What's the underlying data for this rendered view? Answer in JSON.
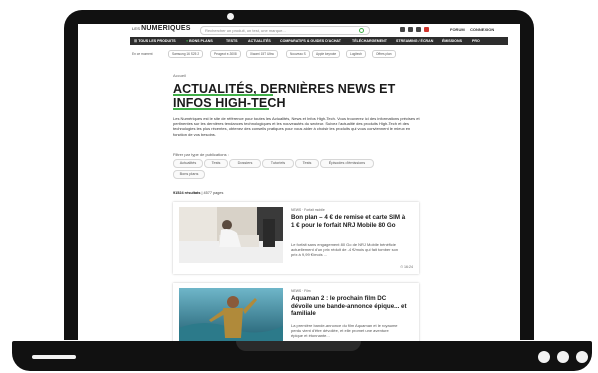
{
  "header": {
    "logo_prefix": "LES",
    "logo": "NUMERIQUES",
    "search_placeholder": "Rechercher un produit, un test, une marque...",
    "forum_label": "FORUM",
    "connexion_label": "CONNEXION"
  },
  "nav": {
    "items": [
      "☰ TOUS LES PRODUITS",
      "BONS PLANS",
      "TESTS",
      "ACTUALITÉS",
      "COMPARATIFS & GUIDES D'ACHAT",
      "TÉLÉCHARGEMENT",
      "STREAMING / ÉCRAN",
      "ÉMISSIONS",
      "PRO"
    ]
  },
  "tags": {
    "first": "En ce moment",
    "items": [
      "Samsung 16 S25 2",
      "Peugeot e-3008",
      "Xiaomi 15T Ultra",
      "Nouveau S",
      "Apple keynote",
      "Logitech",
      "Offres plan"
    ]
  },
  "main": {
    "breadcrumb": "Accueil",
    "title": "ACTUALITÉS, DERNIÈRES NEWS ET INFOS HIGH-TECH",
    "intro": "Les Numériques est le site de référence pour toutes les Actualités, News et Infos High-Tech. Vous trouverez ici des informations précises et pertinentes sur les dernières tendances technologiques et les nouveautés du secteur. Suivez l'actualité des produits High-Tech et des technologies les plus récentes, obtenez des conseils pratiques pour vous aider à choisir les produits qui vous conviennent le mieux en fonction de vos besoins.",
    "filter_label": "Filtrer par type de publications :",
    "filters": [
      "Actualités",
      "Tests",
      "Dossiers",
      "Tutoriels",
      "Tests",
      "Épisodes d'émissions",
      "Bons plans"
    ],
    "results": "91524 résultats",
    "pages": "| 4577 pages"
  },
  "articles": [
    {
      "category": "NEWS · Forfait mobile",
      "title": "Bon plan – 4 € de remise et carte SIM à 1 € pour le forfait NRJ Mobile 80 Go",
      "excerpt": "Le forfait sans engagement 80 Go de NRJ Mobile bénéficie actuellement d'un prix réduit de -4 €/mois qui fait tomber son prix à 9,99 €/mois ...",
      "time": "⏱ 16:24"
    },
    {
      "category": "NEWS · Film",
      "title": "Aquaman 2 : le prochain film DC dévoile une bande-annonce épique... et familiale",
      "excerpt": "La première bande-annonce du film Aquaman et le royaume perdu vient d'être dévoilée, et elle promet une aventure épique et étonnante...",
      "time": ""
    }
  ],
  "colors": {
    "accent": "#41b049",
    "navbar": "#2d2d2d",
    "frame": "#111111"
  }
}
